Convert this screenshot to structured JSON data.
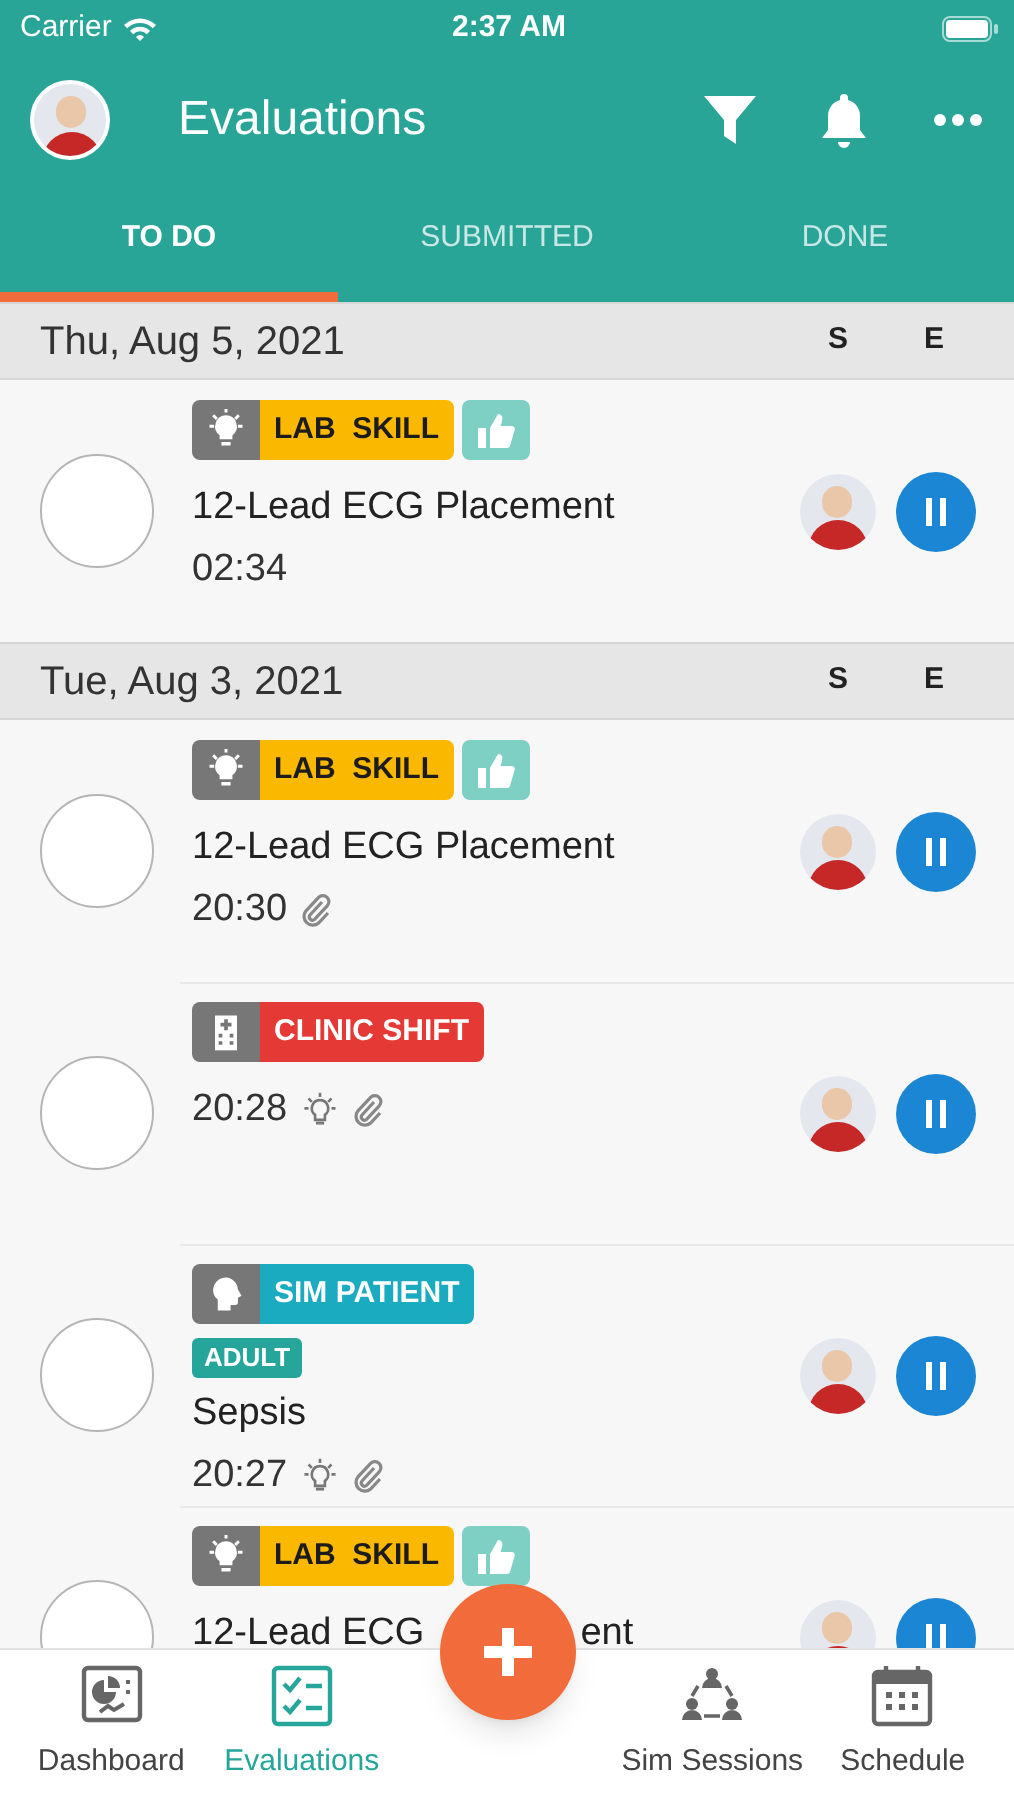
{
  "status_bar": {
    "carrier": "Carrier",
    "time": "2:37 AM"
  },
  "header": {
    "title": "Evaluations"
  },
  "tabs": [
    {
      "label": "TO DO",
      "selected": true
    },
    {
      "label": "SUBMITTED",
      "selected": false
    },
    {
      "label": "DONE",
      "selected": false
    }
  ],
  "sections": [
    {
      "date": "Thu, Aug 5, 2021",
      "col_s": "S",
      "col_e": "E",
      "items": [
        {
          "tag": {
            "kind": "lab_skill",
            "label": "LAB  SKILL"
          },
          "thumbs_up": true,
          "title": "12-Lead ECG Placement",
          "time": "02:34",
          "idea": false,
          "attachment": false
        }
      ]
    },
    {
      "date": "Tue, Aug 3, 2021",
      "col_s": "S",
      "col_e": "E",
      "items": [
        {
          "tag": {
            "kind": "lab_skill",
            "label": "LAB  SKILL"
          },
          "thumbs_up": true,
          "title": "12-Lead ECG Placement",
          "time": "20:30",
          "idea": false,
          "attachment": true
        },
        {
          "tag": {
            "kind": "clinic_shift",
            "label": "CLINIC SHIFT"
          },
          "thumbs_up": false,
          "time": "20:28",
          "idea": true,
          "attachment": true
        },
        {
          "tag": {
            "kind": "sim_patient",
            "label": "SIM PATIENT"
          },
          "thumbs_up": false,
          "subtag": "ADULT",
          "title": "Sepsis",
          "time": "20:27",
          "idea": true,
          "attachment": true
        },
        {
          "tag": {
            "kind": "lab_skill",
            "label": "LAB  SKILL"
          },
          "thumbs_up": true,
          "title": "12-Lead ECG",
          "title_end": "ent",
          "idea": false,
          "attachment": false
        }
      ]
    }
  ],
  "bottom_nav": [
    {
      "kind": "dashboard",
      "label": "Dashboard",
      "selected": false
    },
    {
      "kind": "evaluations",
      "label": "Evaluations",
      "selected": true
    },
    {
      "kind": "spacer"
    },
    {
      "kind": "sim",
      "label": "Sim Sessions",
      "selected": false
    },
    {
      "kind": "schedule",
      "label": "Schedule",
      "selected": false
    }
  ]
}
